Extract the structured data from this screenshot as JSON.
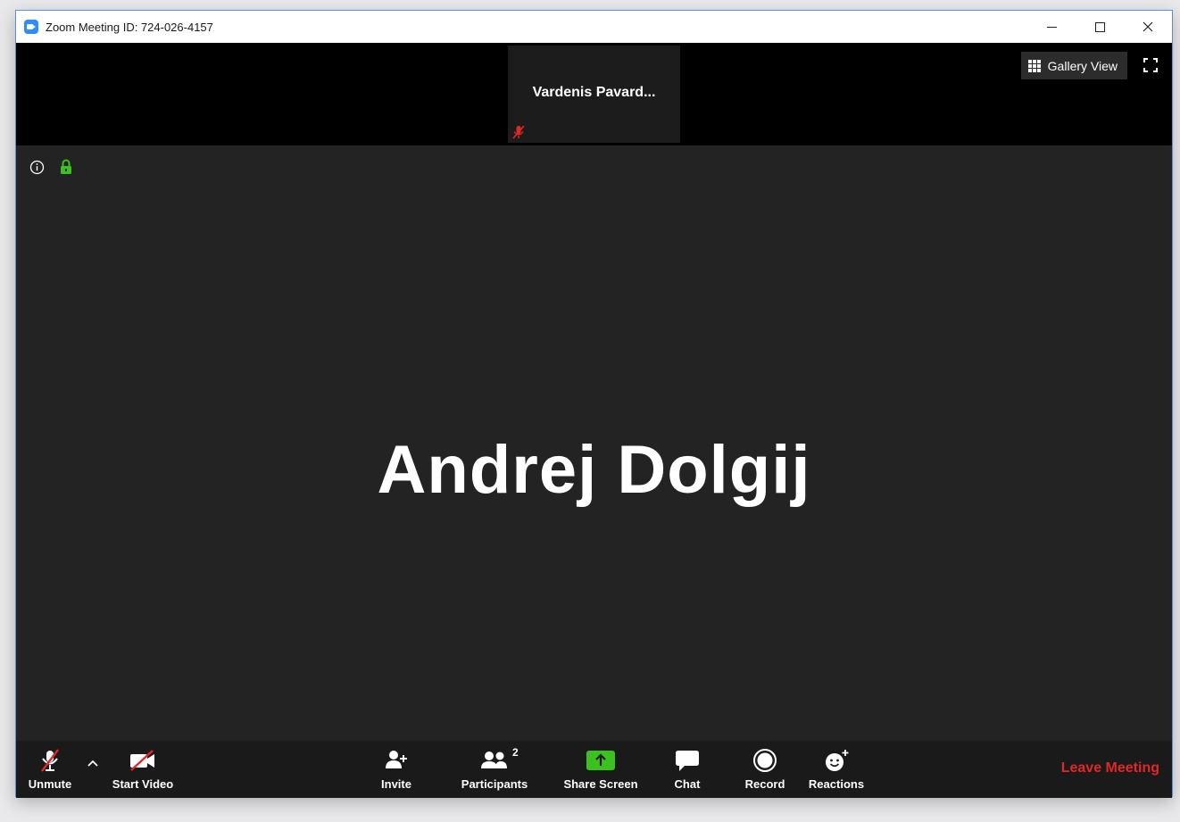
{
  "window": {
    "title": "Zoom Meeting ID: 724-026-4157"
  },
  "top_strip": {
    "thumbnail_name": "Vardenis  Pavard...",
    "gallery_view_label": "Gallery View"
  },
  "main": {
    "active_speaker": "Andrej Dolgij"
  },
  "toolbar": {
    "unmute": "Unmute",
    "start_video": "Start Video",
    "invite": "Invite",
    "participants": "Participants",
    "participants_count": "2",
    "share_screen": "Share Screen",
    "chat": "Chat",
    "record": "Record",
    "reactions": "Reactions",
    "leave": "Leave Meeting"
  },
  "colors": {
    "accent_green": "#3cc21e",
    "leave_red": "#e02828",
    "muted_red": "#e02828"
  },
  "icons": [
    "zoom-logo-icon",
    "minimize-icon",
    "maximize-icon",
    "close-icon",
    "grid-icon",
    "fullscreen-icon",
    "info-icon",
    "lock-icon",
    "mic-muted-icon",
    "chevron-up-icon",
    "video-off-icon",
    "add-person-icon",
    "participants-icon",
    "share-arrow-icon",
    "chat-icon",
    "record-icon",
    "reactions-icon"
  ]
}
